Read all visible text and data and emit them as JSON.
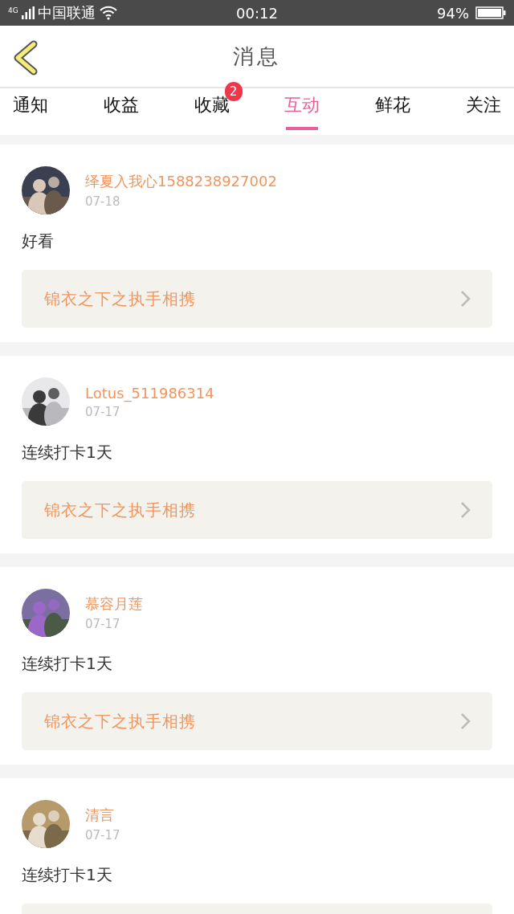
{
  "status_bar": {
    "network": "4G",
    "carrier": "中国联通",
    "time": "00:12",
    "battery": "94%"
  },
  "header": {
    "title": "消息"
  },
  "tabs": [
    {
      "label": "通知",
      "selected": false
    },
    {
      "label": "收益",
      "selected": false
    },
    {
      "label": "收藏",
      "selected": false,
      "badge": "2"
    },
    {
      "label": "互动",
      "selected": true
    },
    {
      "label": "鲜花",
      "selected": false
    },
    {
      "label": "关注",
      "selected": false
    }
  ],
  "messages": [
    {
      "user": "绎夏入我心1588238927002",
      "date": "07-18",
      "text": "好看",
      "book": "锦衣之下之执手相携"
    },
    {
      "user": "Lotus_511986314",
      "date": "07-17",
      "text": "连续打卡1天",
      "book": "锦衣之下之执手相携"
    },
    {
      "user": "慕容月莲",
      "date": "07-17",
      "text": "连续打卡1天",
      "book": "锦衣之下之执手相携"
    },
    {
      "user": "清言",
      "date": "07-17",
      "text": "连续打卡1天"
    }
  ]
}
